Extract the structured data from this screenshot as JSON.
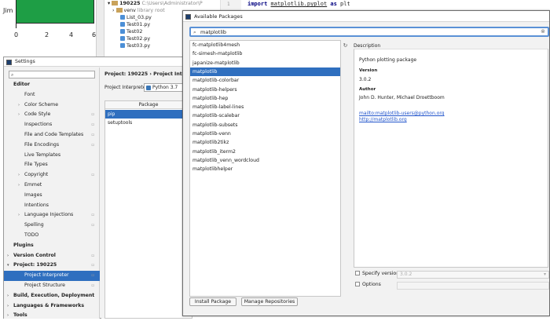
{
  "plot": {
    "ylabel": "Jim",
    "xticks": [
      "0",
      "2",
      "4",
      "6"
    ]
  },
  "project_tree": {
    "root": "190225",
    "root_path": "C:\\Users\\Administrator\\P",
    "venv": "venv",
    "venv_note": "library root",
    "files": [
      "List_03.py",
      "Test01.py",
      "Test02",
      "Test02.py",
      "Test03.py"
    ]
  },
  "editor": {
    "line_number": "1",
    "code_kw_import": "import",
    "code_module": "matplotlib.pyplot",
    "code_as": "as",
    "code_alias": "plt"
  },
  "settings": {
    "title": "Settings",
    "search_placeholder": "",
    "nav": [
      {
        "label": "Editor",
        "bold": true
      },
      {
        "label": "Font"
      },
      {
        "label": "Color Scheme",
        "arrow": true
      },
      {
        "label": "Code Style",
        "arrow": true,
        "cfg": true
      },
      {
        "label": "Inspections",
        "cfg": true
      },
      {
        "label": "File and Code Templates",
        "cfg": true
      },
      {
        "label": "File Encodings",
        "cfg": true
      },
      {
        "label": "Live Templates"
      },
      {
        "label": "File Types"
      },
      {
        "label": "Copyright",
        "arrow": true,
        "cfg": true
      },
      {
        "label": "Emmet",
        "arrow": true
      },
      {
        "label": "Images"
      },
      {
        "label": "Intentions"
      },
      {
        "label": "Language Injections",
        "arrow": true,
        "cfg": true
      },
      {
        "label": "Spelling",
        "cfg": true
      },
      {
        "label": "TODO"
      },
      {
        "label": "Plugins",
        "bold": true
      },
      {
        "label": "Version Control",
        "bold": true,
        "arrow": true,
        "cfg": true
      },
      {
        "label": "Project: 190225",
        "bold": true,
        "arrow": true,
        "cfg": true,
        "open": true
      },
      {
        "label": "Project Interpreter",
        "cfg": true,
        "selected": true
      },
      {
        "label": "Project Structure",
        "cfg": true
      },
      {
        "label": "Build, Execution, Deployment",
        "bold": true,
        "arrow": true
      },
      {
        "label": "Languages & Frameworks",
        "bold": true,
        "arrow": true
      },
      {
        "label": "Tools",
        "bold": true,
        "arrow": true
      }
    ],
    "breadcrumb_project": "Project: 190225",
    "breadcrumb_sep": "›",
    "breadcrumb_page": "Project Interp",
    "interpreter_label": "Project Interpreter:",
    "interpreter_value": "Python 3.7",
    "package_header": "Package",
    "packages": [
      "pip",
      "setuptools"
    ]
  },
  "dialog": {
    "title": "Available Packages",
    "search_value": "matplotlib",
    "packages": [
      "fc-matplotlib4mesh",
      "fc-simesh-matplotlib",
      "japanize-matplotlib",
      "matplotlib",
      "matplotlib-colorbar",
      "matplotlib-helpers",
      "matplotlib-hep",
      "matplotlib-label-lines",
      "matplotlib-scalebar",
      "matplotlib-subsets",
      "matplotlib-venn",
      "matplotlib2tikz",
      "matplotlib_iterm2",
      "matplotlib_venn_wordcloud",
      "matplotlibhelper"
    ],
    "selected_package": "matplotlib",
    "description_label": "Description",
    "description": {
      "summary": "Python plotting package",
      "version_label": "Version",
      "version": "3.0.2",
      "author_label": "Author",
      "author": "John D. Hunter, Michael Droettboom",
      "email": "mailto:matplotlib-users@python.org",
      "url": "http://matplotlib.org"
    },
    "specify_version_label": "Specify version",
    "specify_version_value": "3.0.2",
    "options_label": "Options",
    "install_button": "Install Package",
    "manage_button": "Manage Repositories"
  },
  "colors": {
    "selection": "#2f6fbf",
    "plot_green": "#1e9e45",
    "link": "#2255cc"
  }
}
